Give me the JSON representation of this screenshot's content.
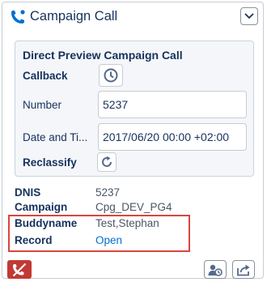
{
  "header": {
    "title": "Campaign Call"
  },
  "card": {
    "title": "Direct Preview Campaign Call",
    "callback_label": "Callback",
    "number_label": "Number",
    "number_value": "5237",
    "datetime_label": "Date and Ti...",
    "datetime_value": "2017/06/20 00:00 +02:00",
    "reclassify_label": "Reclassify"
  },
  "info": {
    "dnis_label": "DNIS",
    "dnis_value": "5237",
    "campaign_label": "Campaign",
    "campaign_value": "Cpg_DEV_PG4",
    "buddyname_label": "Buddyname",
    "buddyname_value": "Test,Stephan",
    "record_label": "Record",
    "record_value": "Open"
  },
  "colors": {
    "accent": "#0070d2",
    "hangup": "#c23934",
    "highlight": "#d8463f"
  },
  "icons": [
    "phone-icon",
    "chevron-down-icon",
    "clock-icon",
    "refresh-icon",
    "hangup-icon",
    "person-clock-icon",
    "share-icon"
  ]
}
